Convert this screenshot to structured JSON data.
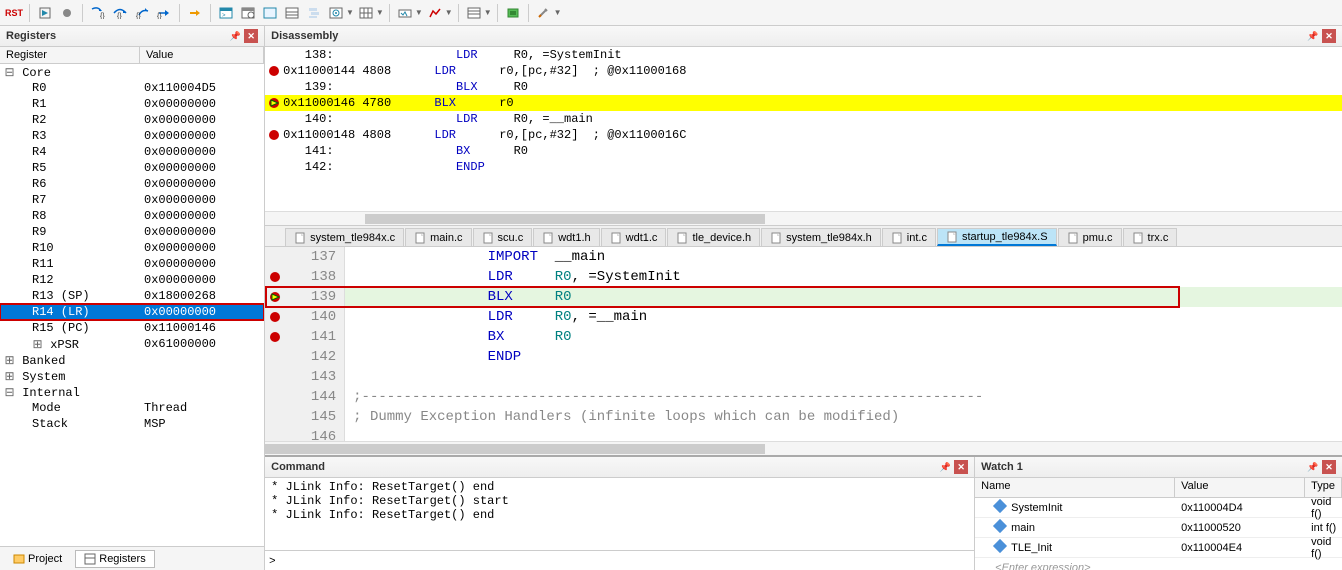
{
  "toolbar": {
    "icons": [
      "RST",
      "save",
      "cancel",
      "step-into",
      "step-over",
      "step-out",
      "run-to",
      "arrow",
      "wnd1",
      "wnd2",
      "wnd3",
      "grid",
      "axe",
      "brk",
      "list",
      "memory",
      "stack",
      "var",
      "wave",
      "chip",
      "tools"
    ]
  },
  "registers": {
    "title": "Registers",
    "cols": {
      "name": "Register",
      "value": "Value"
    },
    "core_label": "Core",
    "rows": [
      {
        "name": "R0",
        "value": "0x110004D5",
        "indent": 2
      },
      {
        "name": "R1",
        "value": "0x00000000",
        "indent": 2
      },
      {
        "name": "R2",
        "value": "0x00000000",
        "indent": 2
      },
      {
        "name": "R3",
        "value": "0x00000000",
        "indent": 2
      },
      {
        "name": "R4",
        "value": "0x00000000",
        "indent": 2
      },
      {
        "name": "R5",
        "value": "0x00000000",
        "indent": 2
      },
      {
        "name": "R6",
        "value": "0x00000000",
        "indent": 2
      },
      {
        "name": "R7",
        "value": "0x00000000",
        "indent": 2
      },
      {
        "name": "R8",
        "value": "0x00000000",
        "indent": 2
      },
      {
        "name": "R9",
        "value": "0x00000000",
        "indent": 2
      },
      {
        "name": "R10",
        "value": "0x00000000",
        "indent": 2
      },
      {
        "name": "R11",
        "value": "0x00000000",
        "indent": 2
      },
      {
        "name": "R12",
        "value": "0x00000000",
        "indent": 2
      },
      {
        "name": "R13 (SP)",
        "value": "0x18000268",
        "indent": 2
      },
      {
        "name": "R14 (LR)",
        "value": "0x00000000",
        "indent": 2,
        "selected": true,
        "redbox": true
      },
      {
        "name": "R15 (PC)",
        "value": "0x11000146",
        "indent": 2
      },
      {
        "name": "xPSR",
        "value": "0x61000000",
        "indent": 2,
        "exp": "+"
      }
    ],
    "groups": [
      {
        "name": "Banked",
        "exp": "+"
      },
      {
        "name": "System",
        "exp": "+"
      },
      {
        "name": "Internal",
        "exp": "-"
      }
    ],
    "internal": [
      {
        "name": "Mode",
        "value": "Thread"
      },
      {
        "name": "Stack",
        "value": "MSP"
      }
    ],
    "tabs": {
      "project": "Project",
      "registers": "Registers"
    }
  },
  "disasm": {
    "title": "Disassembly",
    "lines": [
      {
        "bp": false,
        "text": "   138:                 ",
        "m": "LDR",
        "op": "     R0, =SystemInit"
      },
      {
        "bp": true,
        "addr": "0x11000144 4808      ",
        "m": "LDR",
        "op": "      r0,[pc,#32]  ; @0x11000168"
      },
      {
        "bp": false,
        "text": "   139:                 ",
        "m": "BLX",
        "op": "     R0"
      },
      {
        "bp": true,
        "pc": true,
        "yellow": true,
        "addr": "0x11000146 4780      ",
        "m": "BLX",
        "op": "      r0"
      },
      {
        "bp": false,
        "text": "   140:                 ",
        "m": "LDR",
        "op": "     R0, =__main"
      },
      {
        "bp": true,
        "addr": "0x11000148 4808      ",
        "m": "LDR",
        "op": "      r0,[pc,#32]  ; @0x1100016C"
      },
      {
        "bp": false,
        "text": "   141:                 ",
        "m": "BX",
        "op": "      R0"
      },
      {
        "bp": false,
        "text": "   142:                 ",
        "m": "ENDP",
        "op": ""
      }
    ]
  },
  "tabs": [
    {
      "name": "system_tle984x.c"
    },
    {
      "name": "main.c"
    },
    {
      "name": "scu.c"
    },
    {
      "name": "wdt1.h"
    },
    {
      "name": "wdt1.c"
    },
    {
      "name": "tle_device.h"
    },
    {
      "name": "system_tle984x.h"
    },
    {
      "name": "int.c"
    },
    {
      "name": "startup_tle984x.S",
      "active": true
    },
    {
      "name": "pmu.c"
    },
    {
      "name": "trx.c"
    }
  ],
  "code": {
    "lines": [
      {
        "n": 137,
        "t": "                IMPORT  ",
        "op": "__main"
      },
      {
        "n": 138,
        "bp": true,
        "t": "                LDR     ",
        "reg": "R0",
        ", ": "",
        "lbl": ", =SystemInit"
      },
      {
        "n": 139,
        "bp": true,
        "pc": true,
        "hl": true,
        "t": "                BLX     ",
        "reg": "R0"
      },
      {
        "n": 140,
        "bp": true,
        "t": "                LDR     ",
        "reg": "R0",
        "lbl": ", =__main"
      },
      {
        "n": 141,
        "bp": true,
        "t": "                BX      ",
        "reg": "R0"
      },
      {
        "n": 142,
        "t": "                ENDP"
      },
      {
        "n": 143,
        "t": ""
      },
      {
        "n": 144,
        "sep": ";--------------------------------------------------------------------------"
      },
      {
        "n": 145,
        "cm": "; Dummy Exception Handlers (infinite loops which can be modified)"
      },
      {
        "n": 146,
        "t": ""
      }
    ]
  },
  "command": {
    "title": "Command",
    "lines": [
      "* JLink Info: ResetTarget() end",
      "* JLink Info: ResetTarget() start",
      "* JLink Info: ResetTarget() end"
    ],
    "prompt": ">"
  },
  "watch": {
    "title": "Watch 1",
    "cols": {
      "name": "Name",
      "value": "Value",
      "type": "Type"
    },
    "rows": [
      {
        "name": "SystemInit",
        "value": "0x110004D4",
        "type": "void f()"
      },
      {
        "name": "main",
        "value": "0x11000520",
        "type": "int f()"
      },
      {
        "name": "TLE_Init",
        "value": "0x110004E4",
        "type": "void f()"
      }
    ],
    "enter": "<Enter expression>"
  }
}
